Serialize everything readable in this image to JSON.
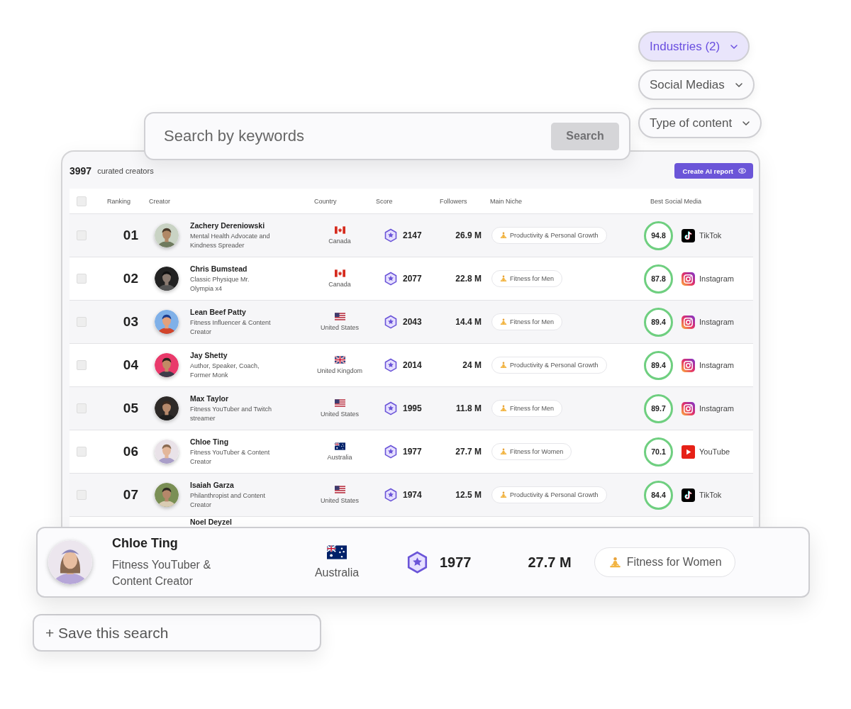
{
  "filters": [
    {
      "label": "Industries (2)",
      "active": true
    },
    {
      "label": "Social Medias",
      "active": false
    },
    {
      "label": "Type of content",
      "active": false
    }
  ],
  "search": {
    "placeholder": "Search by keywords",
    "button": "Search",
    "button_disabled": true
  },
  "results": {
    "count": "3997",
    "count_label": "curated creators",
    "report_button": "Create AI report",
    "select_all_checked": false,
    "columns": [
      "Ranking",
      "Creator",
      "Country",
      "Score",
      "Followers",
      "Main Niche",
      "Best Social Media"
    ],
    "rows": [
      {
        "checked": false,
        "rank": "01",
        "name": "Zachery Dereniowski",
        "description": "Mental Health Advocate and Kindness Spreader",
        "flag": {
          "kind": "ca"
        },
        "country": "Canada",
        "score": "2147",
        "followers": "26.9 M",
        "niche": "Productivity & Personal Growth",
        "rating": "94.8",
        "platform": {
          "kind": "tiktok",
          "label": "TikTok"
        }
      },
      {
        "checked": false,
        "rank": "02",
        "name": "Chris Bumstead",
        "description": "Classic Physique Mr. Olympia x4",
        "flag": {
          "kind": "ca"
        },
        "country": "Canada",
        "score": "2077",
        "followers": "22.8 M",
        "niche": "Fitness for Men",
        "rating": "87.8",
        "platform": {
          "kind": "instagram",
          "label": "Instagram"
        }
      },
      {
        "checked": false,
        "rank": "03",
        "name": "Lean Beef Patty",
        "description": "Fitness Influencer & Content Creator",
        "flag": {
          "kind": "us"
        },
        "country": "United States",
        "score": "2043",
        "followers": "14.4 M",
        "niche": "Fitness for Men",
        "rating": "89.4",
        "platform": {
          "kind": "instagram",
          "label": "Instagram"
        }
      },
      {
        "checked": false,
        "rank": "04",
        "name": "Jay Shetty",
        "description": "Author, Speaker, Coach, Former Monk",
        "flag": {
          "kind": "gb"
        },
        "country": "United Kingdom",
        "score": "2014",
        "followers": "24 M",
        "niche": "Productivity & Personal Growth",
        "rating": "89.4",
        "platform": {
          "kind": "instagram",
          "label": "Instagram"
        }
      },
      {
        "checked": false,
        "rank": "05",
        "name": "Max Taylor",
        "description": "Fitness YouTuber and Twitch streamer",
        "flag": {
          "kind": "us"
        },
        "country": "United States",
        "score": "1995",
        "followers": "11.8 M",
        "niche": "Fitness for Men",
        "rating": "89.7",
        "platform": {
          "kind": "instagram",
          "label": "Instagram"
        }
      },
      {
        "checked": false,
        "rank": "06",
        "name": "Chloe Ting",
        "description": "Fitness YouTuber & Content Creator",
        "flag": {
          "kind": "au"
        },
        "country": "Australia",
        "score": "1977",
        "followers": "27.7 M",
        "niche": "Fitness for Women",
        "rating": "70.1",
        "platform": {
          "kind": "youtube",
          "label": "YouTube"
        }
      },
      {
        "checked": false,
        "rank": "07",
        "name": "Isaiah Garza",
        "description": "Philanthropist and Content Creator",
        "flag": {
          "kind": "us"
        },
        "country": "United States",
        "score": "1974",
        "followers": "12.5 M",
        "niche": "Productivity & Personal Growth",
        "rating": "84.4",
        "platform": {
          "kind": "tiktok",
          "label": "TikTok"
        }
      }
    ],
    "partial_row": {
      "name": "Noel Deyzel"
    }
  },
  "highlight": {
    "name": "Chloe Ting",
    "description": "Fitness YouTuber & Content Creator",
    "flag": {
      "kind": "au"
    },
    "country": "Australia",
    "score": "1977",
    "followers": "27.7 M",
    "niche": "Fitness for Women"
  },
  "save_button": "+ Save this search"
}
